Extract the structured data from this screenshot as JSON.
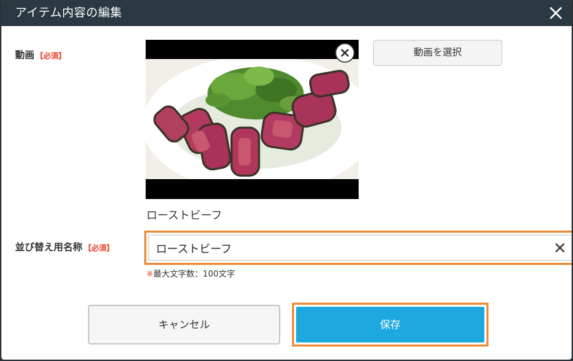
{
  "dialog": {
    "title": "アイテム内容の編集"
  },
  "video_field": {
    "label": "動画",
    "required": "【必須】",
    "select_button": "動画を選択",
    "video_name": "ローストビーフ"
  },
  "sort_name_field": {
    "label": "並び替え用名称",
    "required": "【必須】",
    "value": "ローストビーフ",
    "hint_mark": "※",
    "hint_text": "最大文字数：100文字"
  },
  "buttons": {
    "cancel": "キャンセル",
    "save": "保存"
  },
  "colors": {
    "titlebar": "#2b3a42",
    "required": "#e8452c",
    "highlight": "#ef8a35",
    "save_button": "#1ea8e0"
  },
  "icons": {
    "dialog_close": "close-icon",
    "remove_video": "circle-close-icon",
    "clear_input": "clear-icon"
  }
}
